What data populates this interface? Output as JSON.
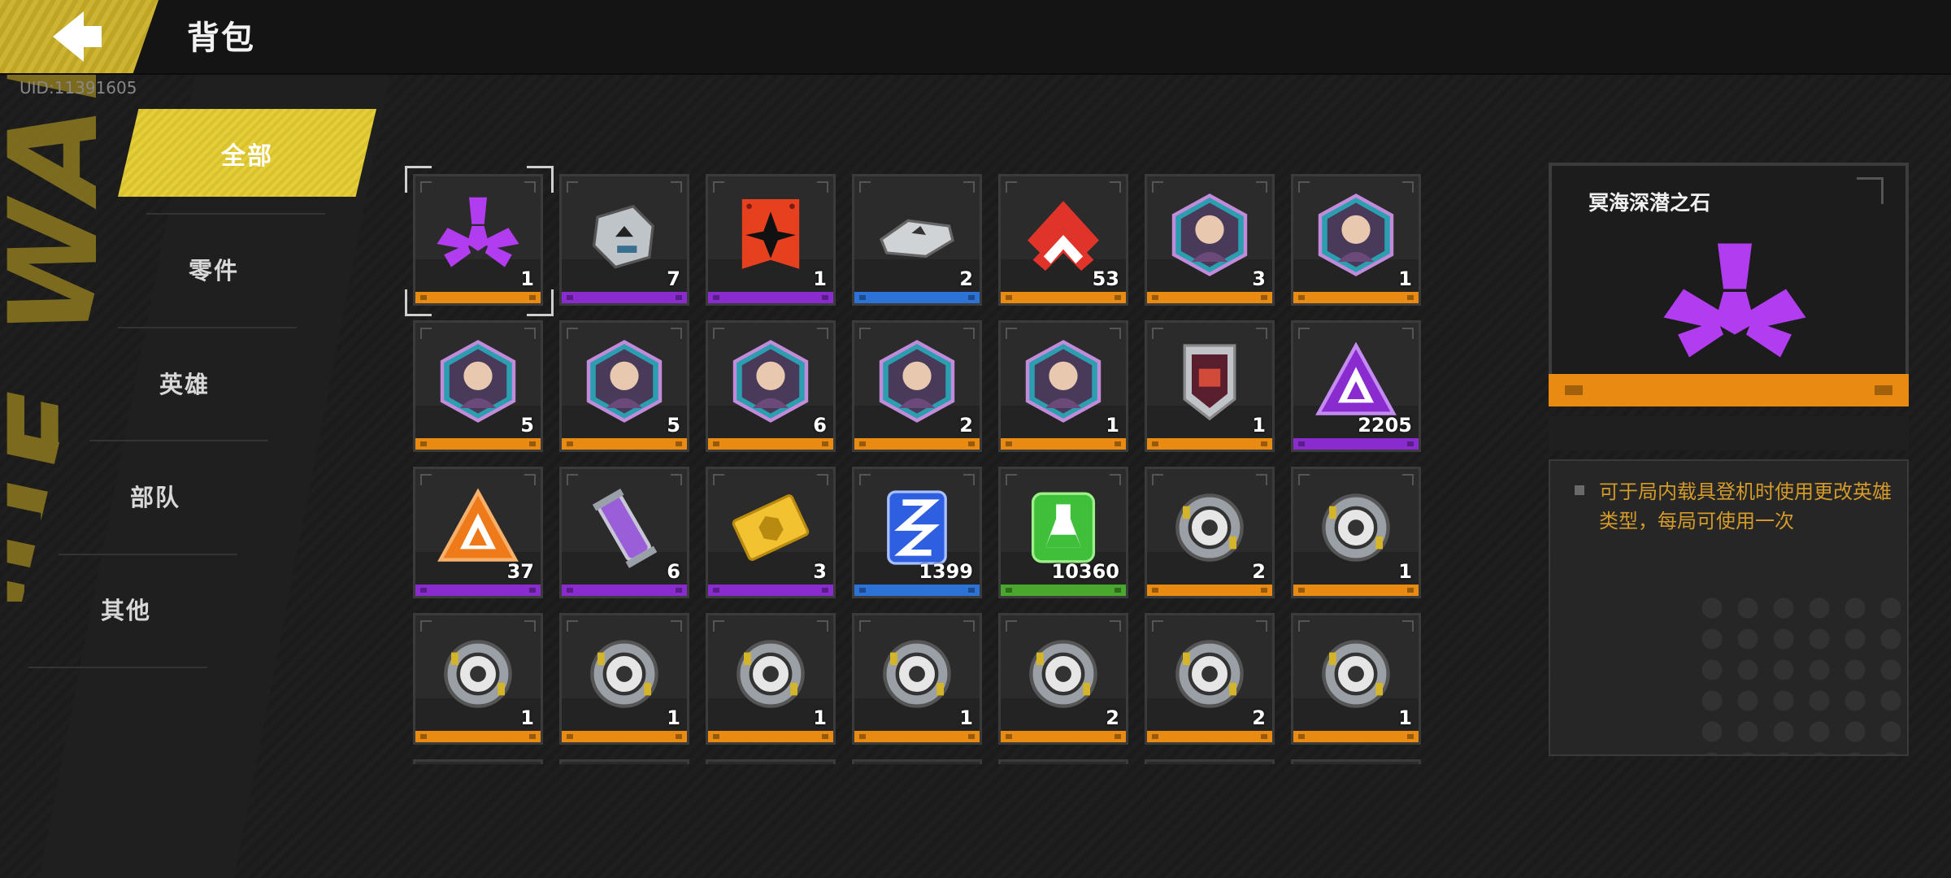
{
  "header": {
    "title": "背包",
    "uid": "UID:11391605"
  },
  "decoration": {
    "side_text": "THE WAR"
  },
  "nav": {
    "active": "全部",
    "items": [
      "零件",
      "英雄",
      "部队",
      "其他"
    ]
  },
  "items": [
    {
      "count": "1",
      "rarity": "orange",
      "icon": "purple-trefoil-icon"
    },
    {
      "count": "7",
      "rarity": "purple",
      "icon": "parts-crate-icon"
    },
    {
      "count": "1",
      "rarity": "purple",
      "icon": "red-banner-icon"
    },
    {
      "count": "2",
      "rarity": "blue",
      "icon": "silver-parts-icon"
    },
    {
      "count": "53",
      "rarity": "orange",
      "icon": "red-chevron-icon"
    },
    {
      "count": "3",
      "rarity": "orange",
      "icon": "hero-portrait-icon"
    },
    {
      "count": "1",
      "rarity": "orange",
      "icon": "hero-portrait-icon"
    },
    {
      "count": "5",
      "rarity": "orange",
      "icon": "hero-portrait-icon"
    },
    {
      "count": "5",
      "rarity": "orange",
      "icon": "hero-portrait-icon"
    },
    {
      "count": "6",
      "rarity": "orange",
      "icon": "hero-portrait-icon"
    },
    {
      "count": "2",
      "rarity": "orange",
      "icon": "hero-portrait-icon"
    },
    {
      "count": "1",
      "rarity": "orange",
      "icon": "hero-portrait-icon"
    },
    {
      "count": "1",
      "rarity": "orange",
      "icon": "unit-shield-icon"
    },
    {
      "count": "2205",
      "rarity": "purple",
      "icon": "purple-triangle-icon"
    },
    {
      "count": "37",
      "rarity": "purple",
      "icon": "orange-triangle-icon"
    },
    {
      "count": "6",
      "rarity": "purple",
      "icon": "purple-vial-icon"
    },
    {
      "count": "3",
      "rarity": "purple",
      "icon": "gold-ticket-icon"
    },
    {
      "count": "1399",
      "rarity": "blue",
      "icon": "blue-dna-icon"
    },
    {
      "count": "10360",
      "rarity": "green",
      "icon": "green-flask-icon"
    },
    {
      "count": "2",
      "rarity": "orange",
      "icon": "gear-module-icon"
    },
    {
      "count": "1",
      "rarity": "orange",
      "icon": "gear-module-icon"
    },
    {
      "count": "1",
      "rarity": "orange",
      "icon": "gear-module-icon"
    },
    {
      "count": "1",
      "rarity": "orange",
      "icon": "gear-module-icon"
    },
    {
      "count": "1",
      "rarity": "orange",
      "icon": "gear-module-icon"
    },
    {
      "count": "1",
      "rarity": "orange",
      "icon": "gear-module-icon"
    },
    {
      "count": "2",
      "rarity": "orange",
      "icon": "gear-module-icon"
    },
    {
      "count": "2",
      "rarity": "orange",
      "icon": "gear-module-icon"
    },
    {
      "count": "1",
      "rarity": "orange",
      "icon": "gear-module-icon"
    }
  ],
  "detail": {
    "name": "冥海深潜之石",
    "rarity": "orange",
    "description": "可于局内载具登机时使用更改英雄类型，每局可使用一次"
  },
  "colors": {
    "accent": "#d9c12f",
    "orange": "#e98a13",
    "purple": "#8a2bcf",
    "blue": "#2d72d6",
    "green": "#49a82d",
    "desc_text": "#d49b2a"
  }
}
